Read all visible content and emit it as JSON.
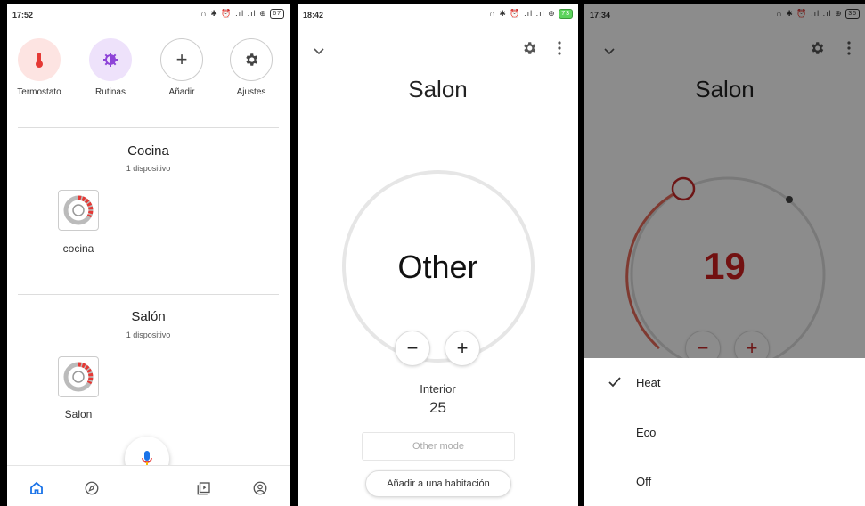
{
  "screen1": {
    "status": {
      "time": "17:52",
      "icons": "∩ ✱ ⏰ .ıl .ıl ⊕",
      "battery": "67"
    },
    "quick_actions": [
      {
        "label": "Termostato",
        "icon": "thermometer-icon"
      },
      {
        "label": "Rutinas",
        "icon": "routines-icon"
      },
      {
        "label": "Añadir",
        "icon": "plus-icon"
      },
      {
        "label": "Ajustes",
        "icon": "gear-icon"
      }
    ],
    "rooms": [
      {
        "title": "Cocina",
        "subtitle": "1 dispositivo",
        "device": "cocina",
        "icon": "thermostat-device-icon"
      },
      {
        "title": "Salón",
        "subtitle": "1 dispositivo",
        "device": "Salon",
        "icon": "thermostat-device-icon"
      }
    ],
    "nav": [
      "home-icon",
      "explore-icon",
      "media-icon",
      "account-icon"
    ],
    "colors": {
      "accent": "#1a73e8",
      "thermo_bg": "#fde4e2",
      "thermo_fg": "#e53935",
      "routine_bg": "#eee2fb",
      "routine_fg": "#8e44d8"
    }
  },
  "screen2": {
    "status": {
      "time": "18:42",
      "icons": "∩ ✱ ⏰ .ıl .ıl ⊕",
      "battery": "73"
    },
    "title": "Salon",
    "dial_text": "Other",
    "minus": "−",
    "plus": "+",
    "interior_label": "Interior",
    "interior_value": "25",
    "mode_placeholder": "Other mode",
    "add_room_label": "Añadir a una habitación"
  },
  "screen3": {
    "status": {
      "time": "17:34",
      "icons": "∩ ✱ ⏰ .ıl .ıl ⊕",
      "battery": "35"
    },
    "title": "Salon",
    "temperature": "19",
    "minus": "−",
    "plus": "+",
    "options": [
      {
        "label": "Heat",
        "selected": true
      },
      {
        "label": "Eco",
        "selected": false
      },
      {
        "label": "Off",
        "selected": false
      }
    ]
  }
}
